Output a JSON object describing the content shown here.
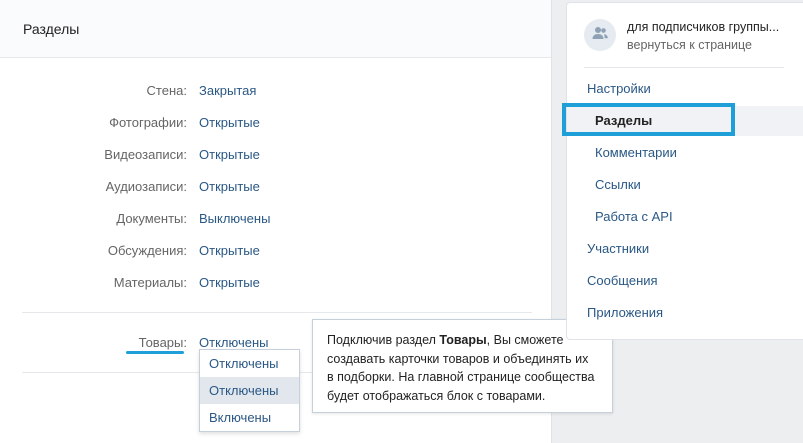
{
  "header": {
    "title": "Разделы"
  },
  "settings": [
    {
      "label": "Стена:",
      "value": "Закрытая"
    },
    {
      "label": "Фотографии:",
      "value": "Открытые"
    },
    {
      "label": "Видеозаписи:",
      "value": "Открытые"
    },
    {
      "label": "Аудиозаписи:",
      "value": "Открытые"
    },
    {
      "label": "Документы:",
      "value": "Выключены"
    },
    {
      "label": "Обсуждения:",
      "value": "Открытые"
    },
    {
      "label": "Материалы:",
      "value": "Открытые"
    }
  ],
  "goods": {
    "label": "Товары:",
    "value": "Отключены",
    "options": [
      "Отключены",
      "Отключены",
      "Включены"
    ],
    "selected_index": 1
  },
  "tooltip": {
    "text_before": "Подключив раздел ",
    "bold": "Товары",
    "text_after": ", Вы сможете создавать карточки товаров и объединять их в подборки. На главной странице сообщества будет отображаться блок с товарами."
  },
  "sidebar": {
    "group_name": "для подписчиков группы...",
    "back_link": "вернуться к странице",
    "avatar_icon": "group-icon",
    "items": [
      {
        "label": "Настройки",
        "level": "top"
      },
      {
        "label": "Разделы",
        "level": "sub",
        "active": true
      },
      {
        "label": "Комментарии",
        "level": "sub"
      },
      {
        "label": "Ссылки",
        "level": "sub"
      },
      {
        "label": "Работа с API",
        "level": "sub"
      },
      {
        "label": "Участники",
        "level": "top"
      },
      {
        "label": "Сообщения",
        "level": "top"
      },
      {
        "label": "Приложения",
        "level": "top"
      }
    ]
  },
  "colors": {
    "link": "#2a5885",
    "highlight": "#1e9fd8",
    "label": "#656565"
  }
}
